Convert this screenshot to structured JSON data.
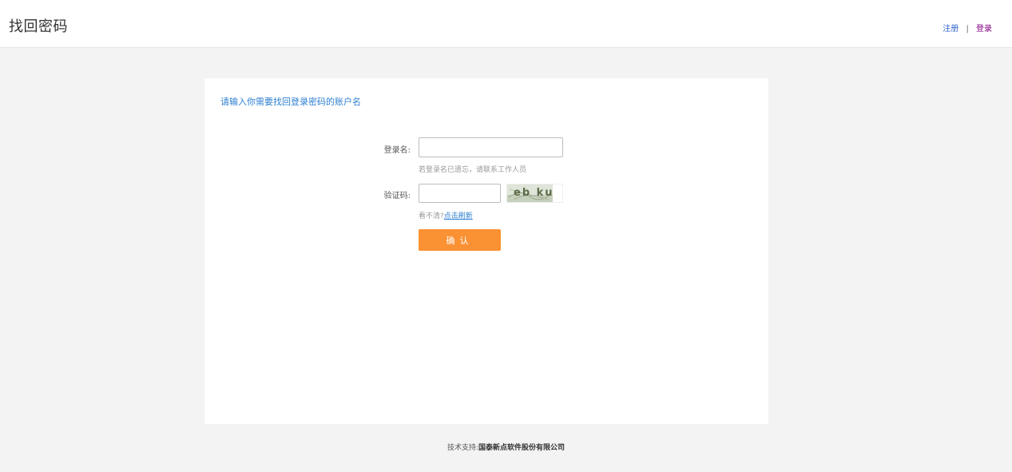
{
  "header": {
    "title": "找回密码",
    "register_label": "注册",
    "separator": "|",
    "login_label": "登录"
  },
  "card": {
    "heading": "请输入你需要找回登录密码的账户名"
  },
  "form": {
    "username_label": "登录名:",
    "username_value": "",
    "username_hint": "若登录名已遗忘，请联系工作人员",
    "captcha_label": "验证码:",
    "captcha_value": "",
    "captcha_text": "eb ku",
    "captcha_hint_prefix": "看不清?",
    "captcha_refresh_label": "点击刷新",
    "confirm_label": "确认"
  },
  "footer": {
    "prefix": "技术支持:",
    "company": "国泰新点软件股份有限公司"
  },
  "colors": {
    "accent_button": "#fa9133",
    "link_blue": "#2e7fd1",
    "visited_link": "#800080"
  }
}
